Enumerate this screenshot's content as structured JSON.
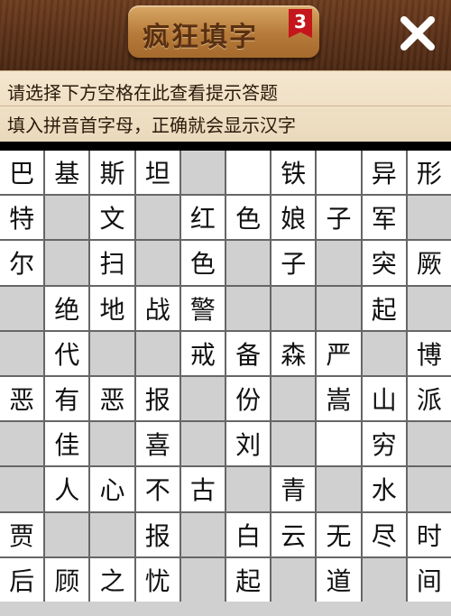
{
  "header": {
    "title": "疯狂填字",
    "level": "3"
  },
  "hint": {
    "line1": "请选择下方空格在此查看提示答题",
    "line2": "填入拼音首字母，正确就会显示汉字"
  },
  "grid": [
    [
      "巴",
      "基",
      "斯",
      "坦",
      null,
      "",
      "铁",
      "",
      "异",
      "形"
    ],
    [
      "特",
      null,
      "文",
      null,
      "红",
      "色",
      "娘",
      "子",
      "军",
      null
    ],
    [
      "尔",
      null,
      "扫",
      null,
      "色",
      null,
      "子",
      null,
      "突",
      "厥"
    ],
    [
      null,
      "绝",
      "地",
      "战",
      "警",
      null,
      null,
      null,
      "起",
      null
    ],
    [
      null,
      "代",
      null,
      null,
      "戒",
      "备",
      "森",
      "严",
      null,
      "博"
    ],
    [
      "恶",
      "有",
      "恶",
      "报",
      null,
      "份",
      null,
      "嵩",
      "山",
      "派"
    ],
    [
      null,
      "佳",
      null,
      "喜",
      null,
      "刘",
      null,
      "",
      "穷",
      null
    ],
    [
      null,
      "人",
      "心",
      "不",
      "古",
      null,
      "青",
      null,
      "水",
      null
    ],
    [
      "贾",
      null,
      null,
      "报",
      null,
      "白",
      "云",
      "无",
      "尽",
      "时"
    ],
    [
      "后",
      "顾",
      "之",
      "忧",
      null,
      "起",
      null,
      "道",
      null,
      "间"
    ]
  ]
}
